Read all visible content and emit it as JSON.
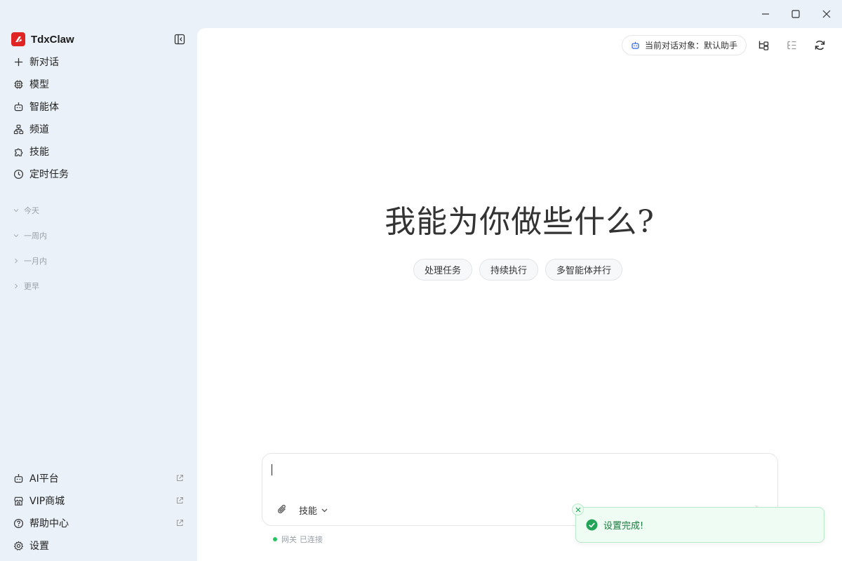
{
  "app": {
    "name": "TdxClaw"
  },
  "window_controls": {
    "minimize_icon": "minimize-icon",
    "maximize_icon": "maximize-icon",
    "close_icon": "close-icon"
  },
  "sidebar": {
    "collapse_icon": "sidebar-collapse-icon",
    "nav": [
      {
        "label": "新对话",
        "icon": "plus-icon"
      },
      {
        "label": "模型",
        "icon": "chip-icon"
      },
      {
        "label": "智能体",
        "icon": "robot-icon"
      },
      {
        "label": "频道",
        "icon": "hierarchy-icon"
      },
      {
        "label": "技能",
        "icon": "puzzle-icon"
      },
      {
        "label": "定时任务",
        "icon": "clock-icon"
      }
    ],
    "history_groups": [
      {
        "label": "今天",
        "expanded": true
      },
      {
        "label": "一周内",
        "expanded": true
      },
      {
        "label": "一月内",
        "expanded": false
      },
      {
        "label": "更早",
        "expanded": false
      }
    ],
    "bottom": [
      {
        "label": "AI平台",
        "icon": "robot-icon",
        "external": true
      },
      {
        "label": "VIP商城",
        "icon": "store-icon",
        "external": true
      },
      {
        "label": "帮助中心",
        "icon": "help-icon",
        "external": true
      },
      {
        "label": "设置",
        "icon": "gear-icon",
        "external": false
      }
    ]
  },
  "header": {
    "agent_pill": "当前对话对象：默认助手",
    "icons": [
      "branch-icon",
      "outline-icon",
      "refresh-icon"
    ]
  },
  "main": {
    "hero": "我能为你做些什么?",
    "chips": [
      "处理任务",
      "持续执行",
      "多智能体并行"
    ],
    "composer": {
      "value": "",
      "skill_label": "技能"
    },
    "status": {
      "label": "网关",
      "state": "已连接",
      "color": "#22c55e"
    }
  },
  "toast": {
    "message": "设置完成!",
    "color": "#22a559"
  },
  "colors": {
    "brand": "#e02424",
    "sidebar_bg": "#eaf1f8"
  }
}
